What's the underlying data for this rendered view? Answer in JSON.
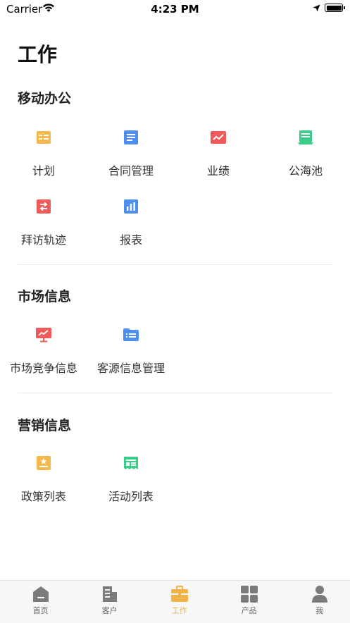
{
  "status_bar": {
    "carrier": "Carrier",
    "time": "4:23 PM"
  },
  "page": {
    "title": "工作"
  },
  "sections": [
    {
      "title": "移动办公",
      "items": [
        {
          "label": "计划",
          "icon": "plan-icon",
          "color": "#f5b94b"
        },
        {
          "label": "合同管理",
          "icon": "contract-icon",
          "color": "#4d8ef0"
        },
        {
          "label": "业绩",
          "icon": "performance-chart-icon",
          "color": "#f05a5a"
        },
        {
          "label": "公海池",
          "icon": "public-pool-icon",
          "color": "#3ccc8a"
        },
        {
          "label": "拜访轨迹",
          "icon": "visit-track-icon",
          "color": "#f05a5a"
        },
        {
          "label": "报表",
          "icon": "report-bar-icon",
          "color": "#4d8ef0"
        }
      ]
    },
    {
      "title": "市场信息",
      "items": [
        {
          "label": "市场竞争信息",
          "icon": "market-board-icon",
          "color": "#f05a5a"
        },
        {
          "label": "客源信息管理",
          "icon": "customer-list-icon",
          "color": "#4d8ef0"
        }
      ]
    },
    {
      "title": "营销信息",
      "items": [
        {
          "label": "政策列表",
          "icon": "policy-icon",
          "color": "#f5b94b"
        },
        {
          "label": "活动列表",
          "icon": "activity-icon",
          "color": "#3ccc8a"
        }
      ]
    }
  ],
  "tabbar": {
    "items": [
      {
        "label": "首页",
        "icon": "home-icon",
        "active": false
      },
      {
        "label": "客户",
        "icon": "building-icon",
        "active": false
      },
      {
        "label": "工作",
        "icon": "briefcase-icon",
        "active": true
      },
      {
        "label": "产品",
        "icon": "grid-icon",
        "active": false
      },
      {
        "label": "我",
        "icon": "person-icon",
        "active": false
      }
    ],
    "active_color": "#f0b446",
    "inactive_color": "#7b7b7b"
  }
}
